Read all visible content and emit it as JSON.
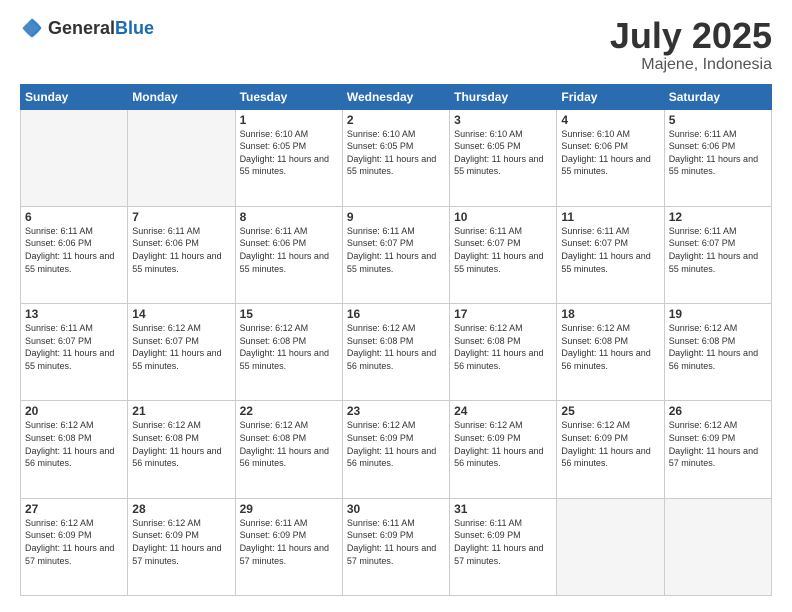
{
  "header": {
    "logo_general": "General",
    "logo_blue": "Blue",
    "month_year": "July 2025",
    "location": "Majene, Indonesia"
  },
  "weekdays": [
    "Sunday",
    "Monday",
    "Tuesday",
    "Wednesday",
    "Thursday",
    "Friday",
    "Saturday"
  ],
  "weeks": [
    [
      {
        "day": "",
        "empty": true
      },
      {
        "day": "",
        "empty": true
      },
      {
        "day": "1",
        "sunrise": "Sunrise: 6:10 AM",
        "sunset": "Sunset: 6:05 PM",
        "daylight": "Daylight: 11 hours and 55 minutes."
      },
      {
        "day": "2",
        "sunrise": "Sunrise: 6:10 AM",
        "sunset": "Sunset: 6:05 PM",
        "daylight": "Daylight: 11 hours and 55 minutes."
      },
      {
        "day": "3",
        "sunrise": "Sunrise: 6:10 AM",
        "sunset": "Sunset: 6:05 PM",
        "daylight": "Daylight: 11 hours and 55 minutes."
      },
      {
        "day": "4",
        "sunrise": "Sunrise: 6:10 AM",
        "sunset": "Sunset: 6:06 PM",
        "daylight": "Daylight: 11 hours and 55 minutes."
      },
      {
        "day": "5",
        "sunrise": "Sunrise: 6:11 AM",
        "sunset": "Sunset: 6:06 PM",
        "daylight": "Daylight: 11 hours and 55 minutes."
      }
    ],
    [
      {
        "day": "6",
        "sunrise": "Sunrise: 6:11 AM",
        "sunset": "Sunset: 6:06 PM",
        "daylight": "Daylight: 11 hours and 55 minutes."
      },
      {
        "day": "7",
        "sunrise": "Sunrise: 6:11 AM",
        "sunset": "Sunset: 6:06 PM",
        "daylight": "Daylight: 11 hours and 55 minutes."
      },
      {
        "day": "8",
        "sunrise": "Sunrise: 6:11 AM",
        "sunset": "Sunset: 6:06 PM",
        "daylight": "Daylight: 11 hours and 55 minutes."
      },
      {
        "day": "9",
        "sunrise": "Sunrise: 6:11 AM",
        "sunset": "Sunset: 6:07 PM",
        "daylight": "Daylight: 11 hours and 55 minutes."
      },
      {
        "day": "10",
        "sunrise": "Sunrise: 6:11 AM",
        "sunset": "Sunset: 6:07 PM",
        "daylight": "Daylight: 11 hours and 55 minutes."
      },
      {
        "day": "11",
        "sunrise": "Sunrise: 6:11 AM",
        "sunset": "Sunset: 6:07 PM",
        "daylight": "Daylight: 11 hours and 55 minutes."
      },
      {
        "day": "12",
        "sunrise": "Sunrise: 6:11 AM",
        "sunset": "Sunset: 6:07 PM",
        "daylight": "Daylight: 11 hours and 55 minutes."
      }
    ],
    [
      {
        "day": "13",
        "sunrise": "Sunrise: 6:11 AM",
        "sunset": "Sunset: 6:07 PM",
        "daylight": "Daylight: 11 hours and 55 minutes."
      },
      {
        "day": "14",
        "sunrise": "Sunrise: 6:12 AM",
        "sunset": "Sunset: 6:07 PM",
        "daylight": "Daylight: 11 hours and 55 minutes."
      },
      {
        "day": "15",
        "sunrise": "Sunrise: 6:12 AM",
        "sunset": "Sunset: 6:08 PM",
        "daylight": "Daylight: 11 hours and 55 minutes."
      },
      {
        "day": "16",
        "sunrise": "Sunrise: 6:12 AM",
        "sunset": "Sunset: 6:08 PM",
        "daylight": "Daylight: 11 hours and 56 minutes."
      },
      {
        "day": "17",
        "sunrise": "Sunrise: 6:12 AM",
        "sunset": "Sunset: 6:08 PM",
        "daylight": "Daylight: 11 hours and 56 minutes."
      },
      {
        "day": "18",
        "sunrise": "Sunrise: 6:12 AM",
        "sunset": "Sunset: 6:08 PM",
        "daylight": "Daylight: 11 hours and 56 minutes."
      },
      {
        "day": "19",
        "sunrise": "Sunrise: 6:12 AM",
        "sunset": "Sunset: 6:08 PM",
        "daylight": "Daylight: 11 hours and 56 minutes."
      }
    ],
    [
      {
        "day": "20",
        "sunrise": "Sunrise: 6:12 AM",
        "sunset": "Sunset: 6:08 PM",
        "daylight": "Daylight: 11 hours and 56 minutes."
      },
      {
        "day": "21",
        "sunrise": "Sunrise: 6:12 AM",
        "sunset": "Sunset: 6:08 PM",
        "daylight": "Daylight: 11 hours and 56 minutes."
      },
      {
        "day": "22",
        "sunrise": "Sunrise: 6:12 AM",
        "sunset": "Sunset: 6:08 PM",
        "daylight": "Daylight: 11 hours and 56 minutes."
      },
      {
        "day": "23",
        "sunrise": "Sunrise: 6:12 AM",
        "sunset": "Sunset: 6:09 PM",
        "daylight": "Daylight: 11 hours and 56 minutes."
      },
      {
        "day": "24",
        "sunrise": "Sunrise: 6:12 AM",
        "sunset": "Sunset: 6:09 PM",
        "daylight": "Daylight: 11 hours and 56 minutes."
      },
      {
        "day": "25",
        "sunrise": "Sunrise: 6:12 AM",
        "sunset": "Sunset: 6:09 PM",
        "daylight": "Daylight: 11 hours and 56 minutes."
      },
      {
        "day": "26",
        "sunrise": "Sunrise: 6:12 AM",
        "sunset": "Sunset: 6:09 PM",
        "daylight": "Daylight: 11 hours and 57 minutes."
      }
    ],
    [
      {
        "day": "27",
        "sunrise": "Sunrise: 6:12 AM",
        "sunset": "Sunset: 6:09 PM",
        "daylight": "Daylight: 11 hours and 57 minutes."
      },
      {
        "day": "28",
        "sunrise": "Sunrise: 6:12 AM",
        "sunset": "Sunset: 6:09 PM",
        "daylight": "Daylight: 11 hours and 57 minutes."
      },
      {
        "day": "29",
        "sunrise": "Sunrise: 6:11 AM",
        "sunset": "Sunset: 6:09 PM",
        "daylight": "Daylight: 11 hours and 57 minutes."
      },
      {
        "day": "30",
        "sunrise": "Sunrise: 6:11 AM",
        "sunset": "Sunset: 6:09 PM",
        "daylight": "Daylight: 11 hours and 57 minutes."
      },
      {
        "day": "31",
        "sunrise": "Sunrise: 6:11 AM",
        "sunset": "Sunset: 6:09 PM",
        "daylight": "Daylight: 11 hours and 57 minutes."
      },
      {
        "day": "",
        "empty": true
      },
      {
        "day": "",
        "empty": true
      }
    ]
  ]
}
